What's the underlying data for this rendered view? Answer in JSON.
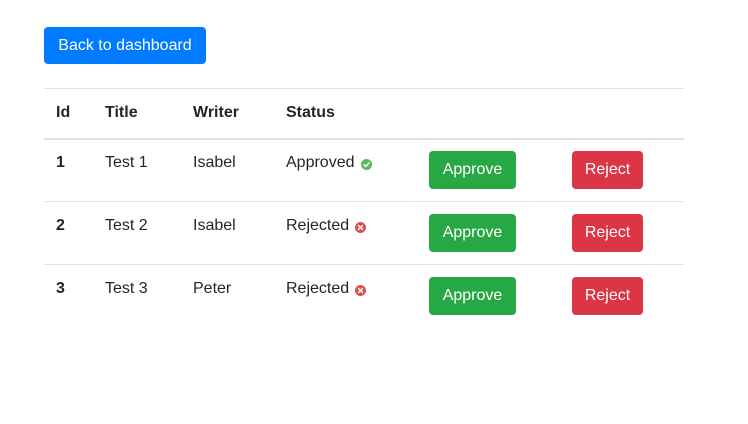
{
  "back_button": {
    "label": "Back to dashboard"
  },
  "table": {
    "headers": {
      "id": "Id",
      "title": "Title",
      "writer": "Writer",
      "status": "Status"
    },
    "rows": [
      {
        "id": "1",
        "title": "Test 1",
        "writer": "Isabel",
        "status": "Approved",
        "status_icon": "check-circle-icon",
        "approve_label": "Approve",
        "reject_label": "Reject"
      },
      {
        "id": "2",
        "title": "Test 2",
        "writer": "Isabel",
        "status": "Rejected",
        "status_icon": "x-circle-icon",
        "approve_label": "Approve",
        "reject_label": "Reject"
      },
      {
        "id": "3",
        "title": "Test 3",
        "writer": "Peter",
        "status": "Rejected",
        "status_icon": "x-circle-icon",
        "approve_label": "Approve",
        "reject_label": "Reject"
      }
    ]
  },
  "colors": {
    "primary": "#007bff",
    "success": "#28a745",
    "danger": "#dc3545",
    "approved_icon": "#5cb85c",
    "rejected_icon": "#d9534f"
  }
}
